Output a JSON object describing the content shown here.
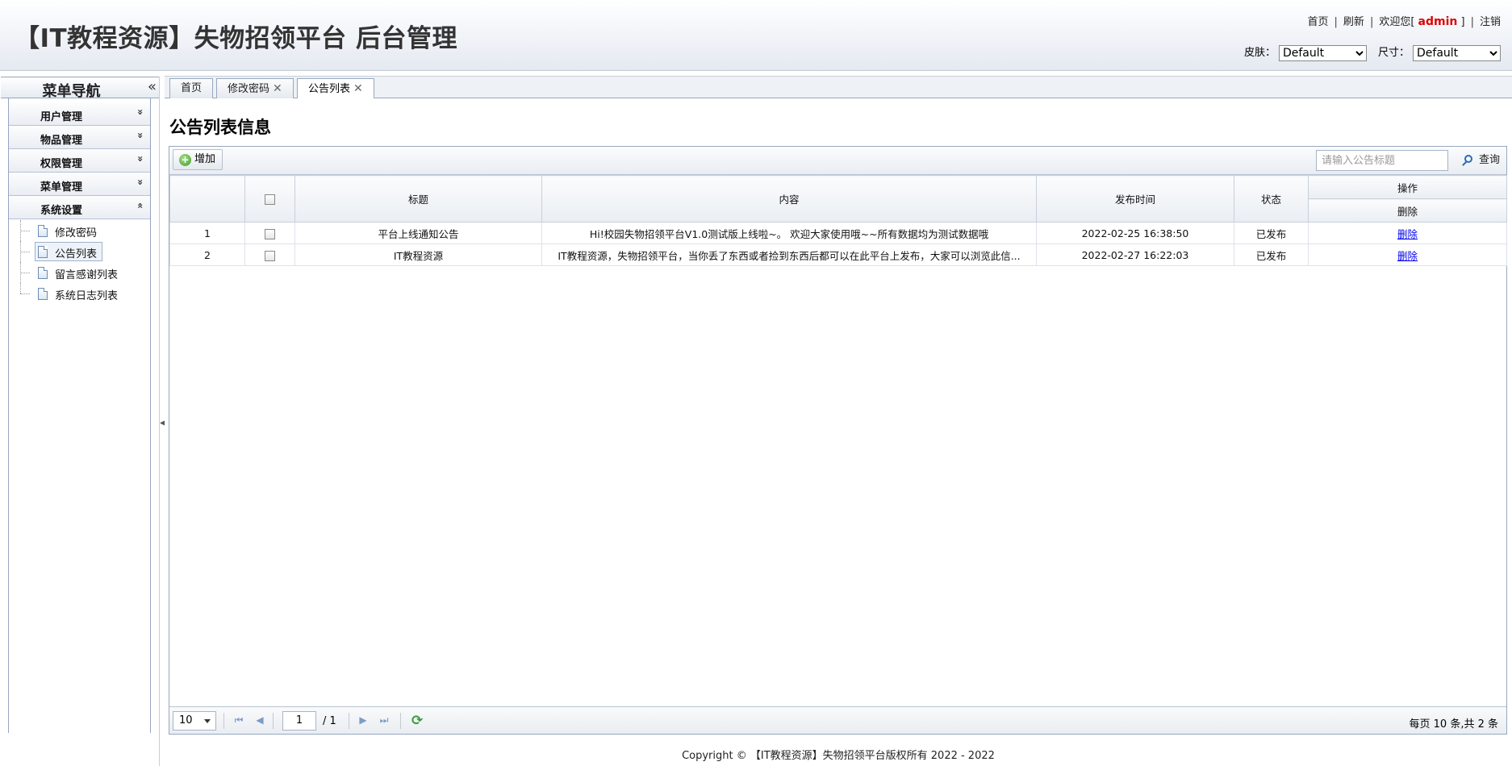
{
  "header": {
    "title": "【IT教程资源】失物招领平台 后台管理",
    "links": {
      "home": "首页",
      "refresh": "刷新",
      "welcome_prefix": "欢迎您[",
      "username": "admin",
      "welcome_suffix": "]",
      "logout": "注销"
    },
    "skin_label": "皮肤：",
    "skin_value": "Default",
    "size_label": "尺寸：",
    "size_value": "Default"
  },
  "sidebar": {
    "title": "菜单导航",
    "collapse_glyph": "«",
    "sections": [
      {
        "label": "用户管理",
        "arrow": "»"
      },
      {
        "label": "物品管理",
        "arrow": "»"
      },
      {
        "label": "权限管理",
        "arrow": "»"
      },
      {
        "label": "菜单管理",
        "arrow": "»"
      },
      {
        "label": "系统设置",
        "arrow": "«"
      }
    ],
    "tree_items": [
      {
        "label": "修改密码"
      },
      {
        "label": "公告列表",
        "selected": true
      },
      {
        "label": "留言感谢列表"
      },
      {
        "label": "系统日志列表"
      }
    ]
  },
  "tabs": [
    {
      "label": "首页",
      "closable": false
    },
    {
      "label": "修改密码",
      "closable": true
    },
    {
      "label": "公告列表",
      "closable": true,
      "active": true
    }
  ],
  "main": {
    "page_title": "公告列表信息",
    "add_button": "增加",
    "search_placeholder": "请输入公告标题",
    "search_button": "查询",
    "columns": {
      "title": "标题",
      "content": "内容",
      "time": "发布时间",
      "status": "状态",
      "ops": "操作",
      "ops_sub": "删除"
    },
    "rows": [
      {
        "num": "1",
        "title": "平台上线通知公告",
        "content": "Hi!校园失物招领平台V1.0测试版上线啦~。 欢迎大家使用哦~~所有数据均为测试数据哦",
        "time": "2022-02-25 16:38:50",
        "status": "已发布",
        "action": "删除"
      },
      {
        "num": "2",
        "title": "IT教程资源",
        "content": "IT教程资源，失物招领平台，当你丢了东西或者捡到东西后都可以在此平台上发布，大家可以浏览此信...",
        "time": "2022-02-27 16:22:03",
        "status": "已发布",
        "action": "删除"
      }
    ],
    "pager": {
      "page_size": "10",
      "current_page": "1",
      "total_pages": "/ 1",
      "info": "每页 10 条,共 2 条"
    }
  },
  "footer": "Copyright © 【IT教程资源】失物招领平台版权所有  2022 - 2022",
  "colors": {
    "accent_link": "#0000ee",
    "username": "#e00000",
    "border": "#99a8bf"
  }
}
